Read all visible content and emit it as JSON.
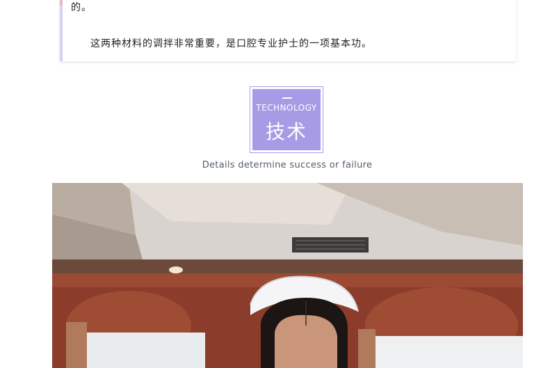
{
  "quote": {
    "line1": "的。",
    "line2": "这两种材料的调拌非常重要，是口腔专业护士的一项基本功。"
  },
  "section": {
    "badge_en": "TECHNOLOGY",
    "badge_cn": "技术",
    "subtitle": "Details determine success or failure",
    "accent_color": "#a89be6"
  },
  "photo": {
    "description_icon": "nurse-photo"
  }
}
